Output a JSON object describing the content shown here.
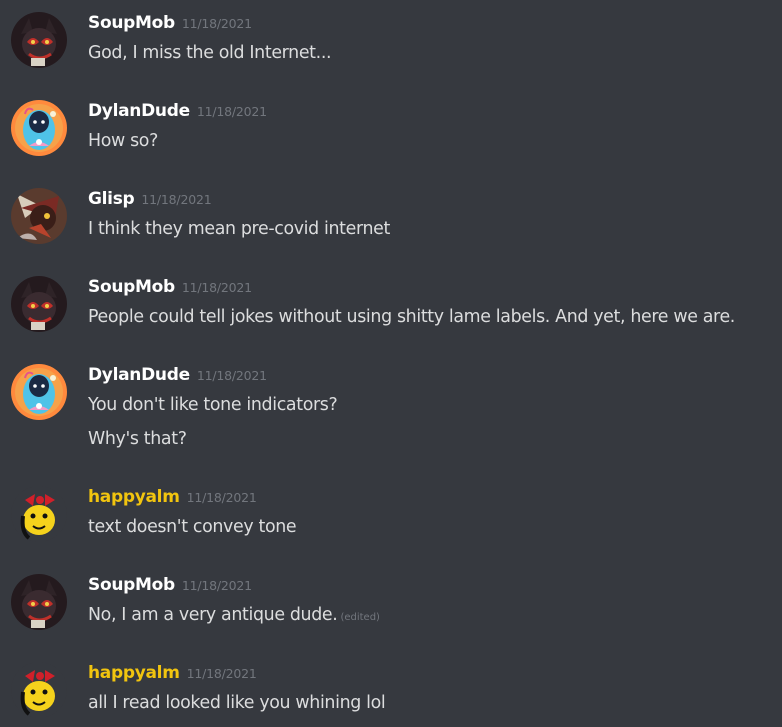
{
  "messages": [
    {
      "username": "SoupMob",
      "timestamp": "11/18/2021",
      "avatar": "soupmob-avatar",
      "name_color": "#ffffff",
      "lines": [
        "God, I miss the old Internet..."
      ]
    },
    {
      "username": "DylanDude",
      "timestamp": "11/18/2021",
      "avatar": "dylandude-avatar",
      "name_color": "#ffffff",
      "lines": [
        "How so?"
      ]
    },
    {
      "username": "Glisp",
      "timestamp": "11/18/2021",
      "avatar": "glisp-avatar",
      "name_color": "#ffffff",
      "lines": [
        "I think they mean pre-covid internet"
      ]
    },
    {
      "username": "SoupMob",
      "timestamp": "11/18/2021",
      "avatar": "soupmob-avatar",
      "name_color": "#ffffff",
      "lines": [
        "People could tell jokes without using shitty lame labels. And yet, here we are."
      ]
    },
    {
      "username": "DylanDude",
      "timestamp": "11/18/2021",
      "avatar": "dylandude-avatar",
      "name_color": "#ffffff",
      "lines": [
        "You don't like tone indicators?",
        "Why's that?"
      ]
    },
    {
      "username": "happyalm",
      "timestamp": "11/18/2021",
      "avatar": "happyalm-avatar",
      "name_color": "#f1c40f",
      "lines": [
        "text doesn't convey tone"
      ]
    },
    {
      "username": "SoupMob",
      "timestamp": "11/18/2021",
      "avatar": "soupmob-avatar",
      "name_color": "#ffffff",
      "lines": [
        "No, I am a very antique dude."
      ],
      "edited": "(edited)"
    },
    {
      "username": "happyalm",
      "timestamp": "11/18/2021",
      "avatar": "happyalm-avatar",
      "name_color": "#f1c40f",
      "lines": [
        "all I read looked like you whining lol"
      ]
    }
  ],
  "colors": {
    "background": "#36393f",
    "text": "#dcddde",
    "timestamp": "#72767d",
    "username_default": "#ffffff",
    "username_gold": "#f1c40f"
  }
}
